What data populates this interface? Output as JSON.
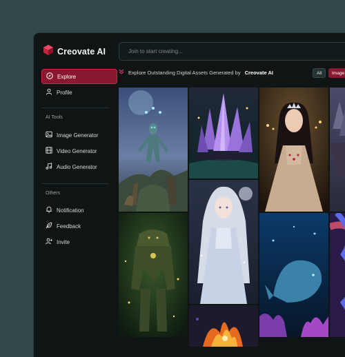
{
  "app": {
    "name": "Creovate AI"
  },
  "sidebar": {
    "nav": [
      {
        "label": "Explore",
        "icon": "compass-icon",
        "active": true
      },
      {
        "label": "Profile",
        "icon": "user-icon",
        "active": false
      }
    ],
    "ai_tools_title": "AI Tools",
    "ai_tools": [
      {
        "label": "Image Generator",
        "icon": "image-icon"
      },
      {
        "label": "Video Generator",
        "icon": "film-icon"
      },
      {
        "label": "Audio Generator",
        "icon": "music-icon"
      }
    ],
    "others_title": "Others",
    "others": [
      {
        "label": "Notification",
        "icon": "bell-icon"
      },
      {
        "label": "Feedback",
        "icon": "feather-icon"
      },
      {
        "label": "Invite",
        "icon": "user-plus-icon"
      }
    ]
  },
  "search": {
    "placeholder": "Join to start creating..."
  },
  "explore": {
    "heading_prefix": "Explore Outstanding Digital Assets Generated by",
    "heading_brand": "Creovate AI",
    "filters": [
      "All",
      "Image"
    ]
  },
  "gallery": [
    {
      "name": "alien-gathering-image"
    },
    {
      "name": "purple-crystal-image"
    },
    {
      "name": "princess-portrait-image"
    },
    {
      "name": "floating-island-image"
    },
    {
      "name": "forest-golem-image"
    },
    {
      "name": "silver-anime-girl-image"
    },
    {
      "name": "underwater-whale-image"
    },
    {
      "name": "abstract-swirl-image"
    },
    {
      "name": "fire-creature-image"
    }
  ],
  "colors": {
    "accent": "#8a1830",
    "background": "#0f1415",
    "backdrop": "#34494a"
  }
}
